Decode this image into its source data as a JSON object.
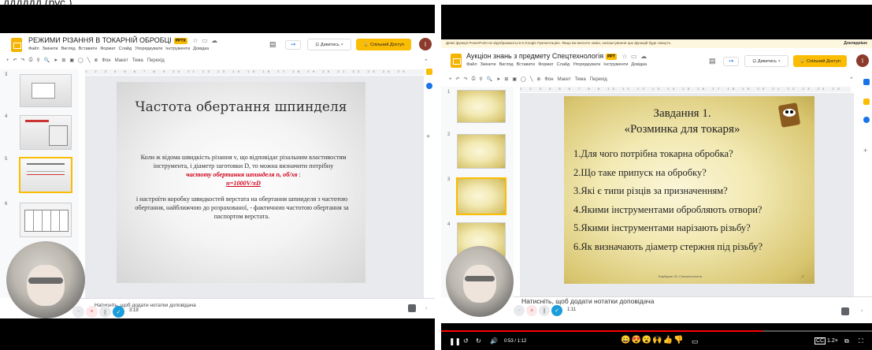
{
  "caption_fragment": "дддддд (рус.)",
  "left": {
    "doc_title": "РЕЖИМИ РІЗАННЯ В ТОКАРНІЙ ОБРОБЦІ",
    "badge": "PPTX",
    "menu": [
      "Файл",
      "Змінити",
      "Вигляд",
      "Вставити",
      "Формат",
      "Слайд",
      "Упорядкувати",
      "Інструменти",
      "Довідка"
    ],
    "present_label": "Дивитись",
    "share_label": "Спільний Доступ",
    "avatar_letter": "I",
    "toolbar_tail": [
      "Фон",
      "Макет",
      "Тема",
      "Перехід"
    ],
    "thumb_numbers": [
      "3",
      "4",
      "5",
      "6"
    ],
    "slide": {
      "title": "Частота обертання шпинделя",
      "body_1": "Коли ж відома швидкість різання v, що відповідає різальним властивостям інструмента, і діаметр заготовки D, то можна визначити потрібну",
      "highlight": "частоту обертання шпинделя n, об/хв",
      "formula": "n=1000V/πD",
      "body_2": "і настроїти коробку швидкостей верстата на обертання шпинделя з частотою обертання, найближчою до розрахованої, - фактичною частотою обертання за паспортом верстата."
    },
    "notes": "Натисніть, щоб додати нотатки доповідача",
    "timer": "3:19"
  },
  "right": {
    "warning": "Деякі функції PowerPoint не відображаються в Google Презентаціях. Якщо ви внесете зміни, налаштування цих функцій буде скинуто.",
    "warning_link": "Докладніше",
    "doc_title": "Аукціон знань з предмету Спецтехнологія",
    "badge": "PPT",
    "menu": [
      "Файл",
      "Змінити",
      "Вигляд",
      "Вставити",
      "Формат",
      "Слайд",
      "Упорядкувати",
      "Інструменти",
      "Довідка"
    ],
    "present_label": "Дивитись",
    "share_label": "Спільний Доступ",
    "avatar_letter": "I",
    "toolbar_tail": [
      "Фон",
      "Макет",
      "Тема",
      "Перехід"
    ],
    "thumb_numbers": [
      "1",
      "2",
      "3",
      "4"
    ],
    "slide": {
      "title_1": "Завдання 1.",
      "title_2": "«Розминка для токаря»",
      "items": [
        "1.Для чого потрібна токарна обробка?",
        "2.Що таке припуск на обробку?",
        "3.Які є типи різців за призначенням?",
        "4.Якими інструментами обробляють отвори?",
        "5.Якими інструментами нарізають різьбу?",
        "6.Як визначають діаметр стержня під різьбу?"
      ],
      "footer": "Барбарик І.В.   Спецтехнологія",
      "page": "2"
    },
    "notes": "Натисніть, щоб додати нотатки доповідача",
    "timer": "1:11"
  },
  "player": {
    "time": "0:53 / 1:12",
    "speed": "1.2×",
    "emoji": "😀😍😮🙌👍👎"
  },
  "colors": {
    "accent_yellow": "#fbbc04",
    "highlight_red": "#d0021b",
    "progress_red": "#ff0000",
    "slide_text_gold": "#222222"
  }
}
